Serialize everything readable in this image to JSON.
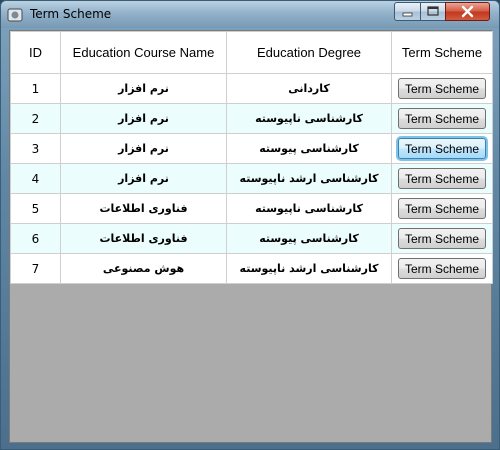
{
  "window": {
    "title": "Term Scheme"
  },
  "grid": {
    "columns": [
      "ID",
      "Education Course Name",
      "Education Degree",
      "Term Scheme"
    ],
    "rows": [
      {
        "id": "1",
        "course": "نرم افزار",
        "degree": "کاردانی",
        "action": "Term Scheme"
      },
      {
        "id": "2",
        "course": "نرم افزار",
        "degree": "کارشناسی ناپیوسته",
        "action": "Term Scheme"
      },
      {
        "id": "3",
        "course": "نرم افزار",
        "degree": "کارشناسی پیوسته",
        "action": "Term Scheme"
      },
      {
        "id": "4",
        "course": "نرم افزار",
        "degree": "کارشناسی ارشد ناپیوسته",
        "action": "Term Scheme"
      },
      {
        "id": "5",
        "course": "فناوری اطلاعات",
        "degree": "کارشناسی ناپیوسته",
        "action": "Term Scheme"
      },
      {
        "id": "6",
        "course": "فناوری اطلاعات",
        "degree": "کارشناسی پیوسته",
        "action": "Term Scheme"
      },
      {
        "id": "7",
        "course": "هوش مصنوعی",
        "degree": "کارشناسی ارشد ناپیوسته",
        "action": "Term Scheme"
      }
    ]
  }
}
